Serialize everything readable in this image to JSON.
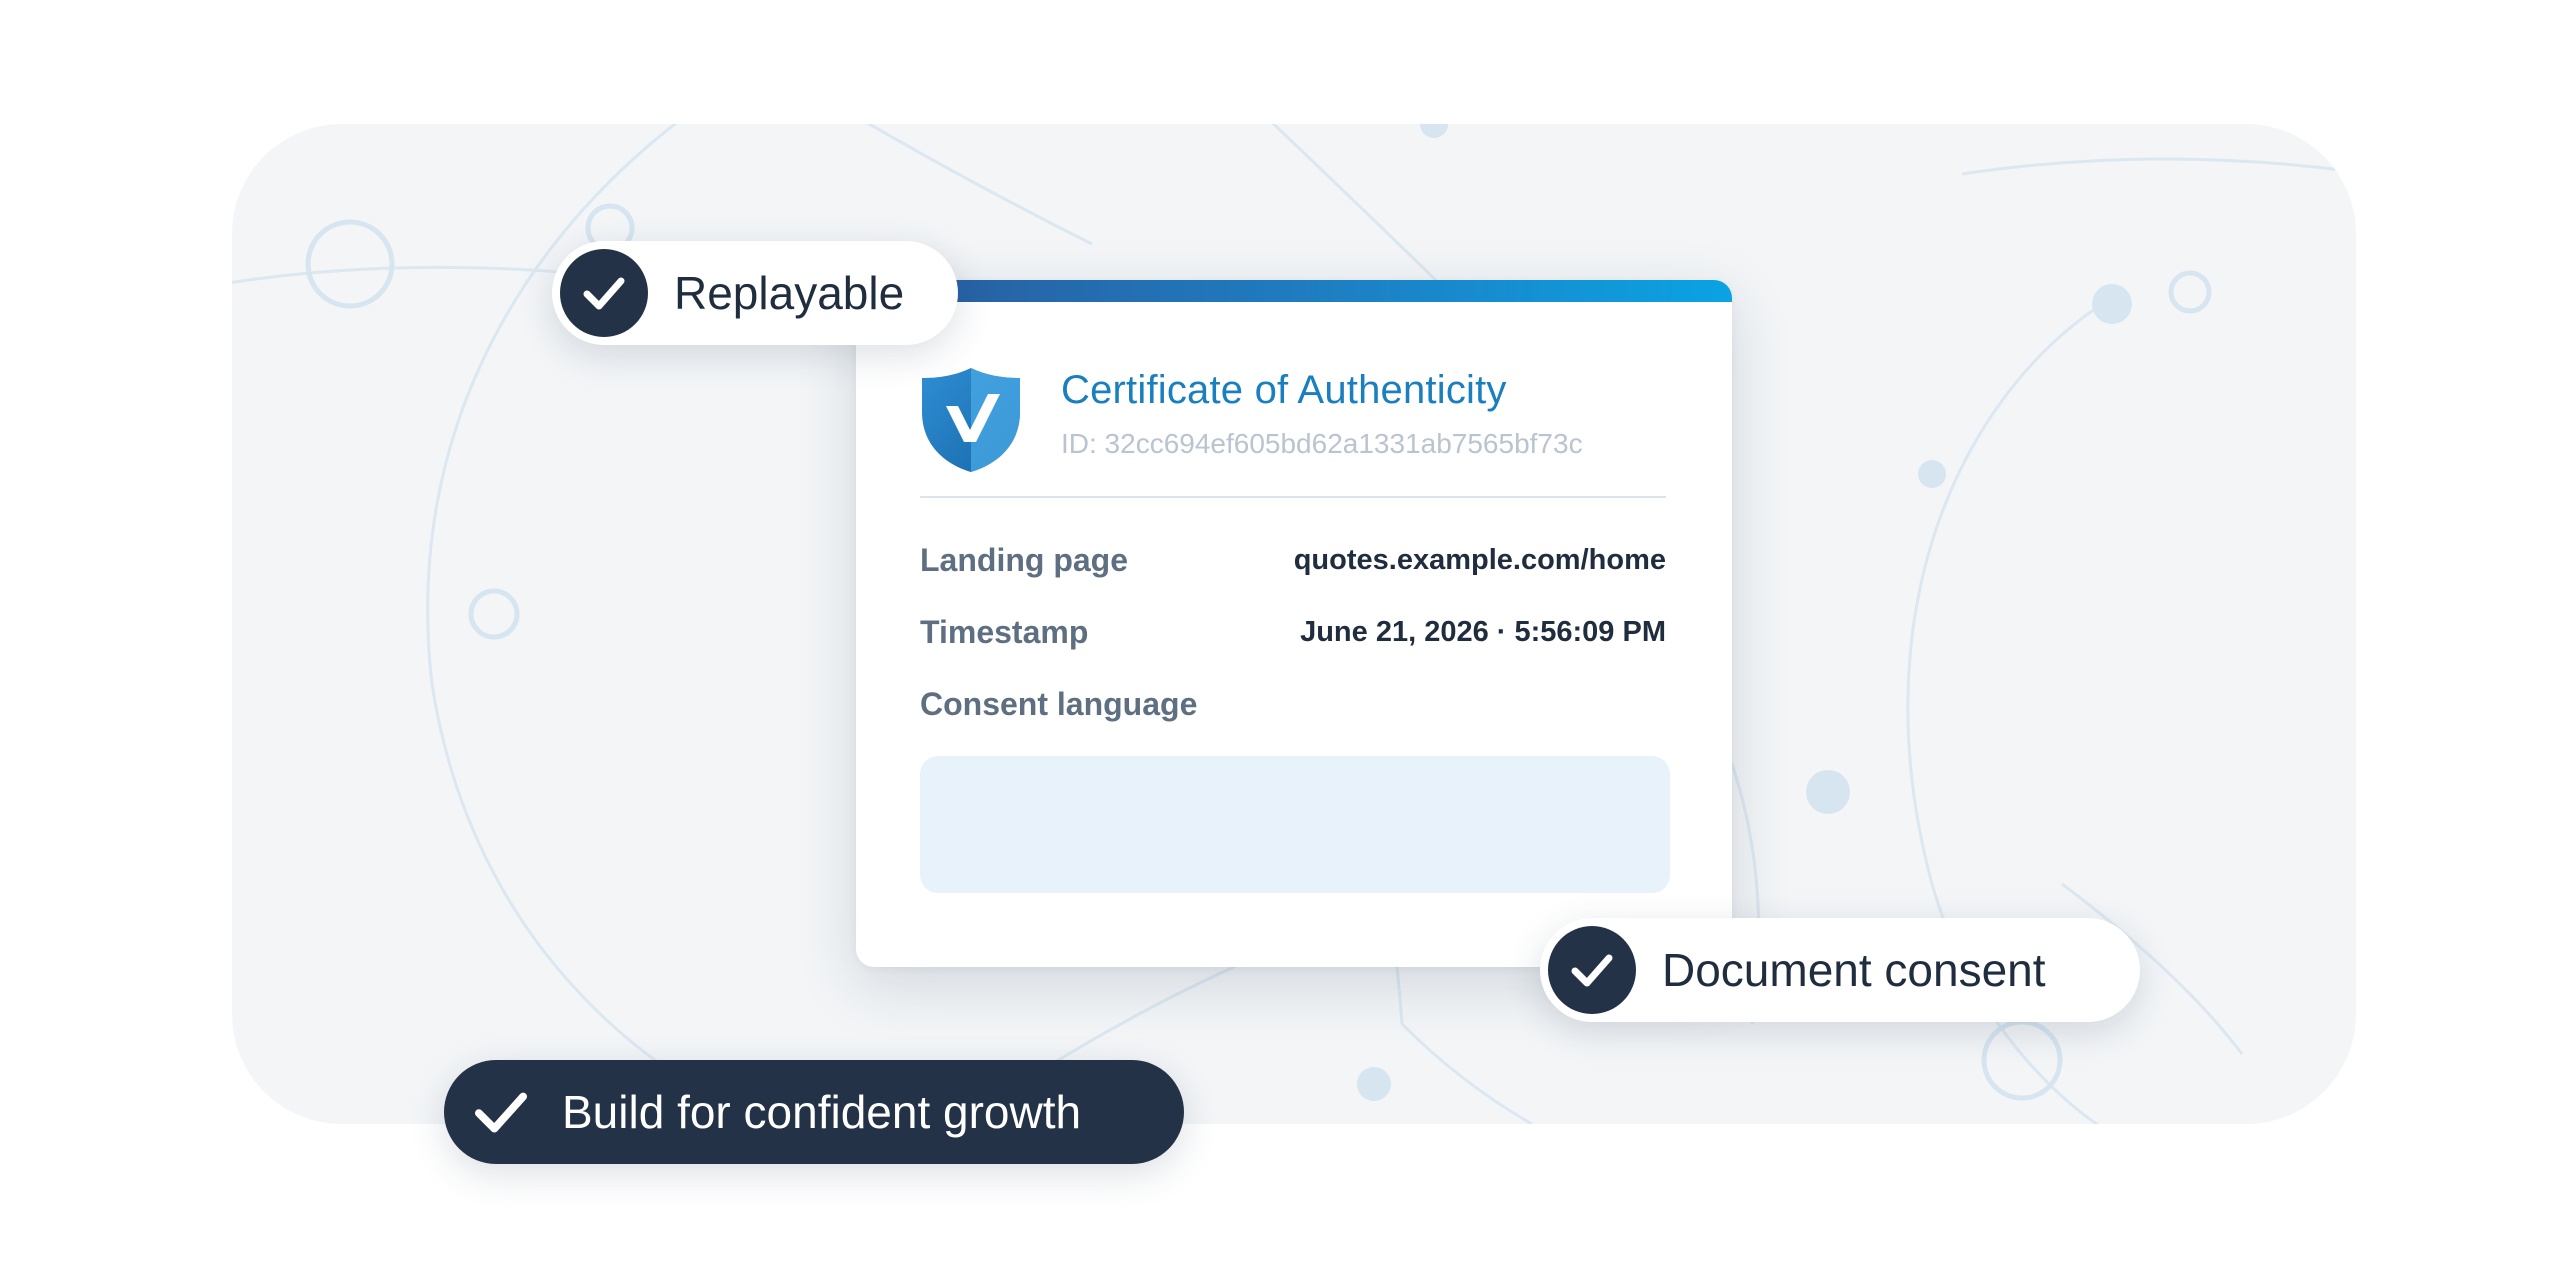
{
  "certificate": {
    "title": "Certificate of Authenticity",
    "id_text": "ID: 32cc694ef605bd62a1331ab7565bf73c",
    "rows": [
      {
        "label": "Landing page",
        "value": "quotes.example.com/home"
      },
      {
        "label": "Timestamp",
        "value": "June 21, 2026 · 5:56:09 PM"
      },
      {
        "label": "Consent language",
        "value": ""
      }
    ]
  },
  "badges": {
    "replayable": "Replayable",
    "document_consent": "Document consent",
    "build": "Build for confident growth"
  },
  "icons": {
    "logo": "shield-check-icon",
    "check": "check-icon"
  },
  "colors": {
    "accent": "#1a7fbf",
    "dark": "#233247",
    "panel": "#f3f5f7",
    "consent_box": "#e8f2fb"
  }
}
